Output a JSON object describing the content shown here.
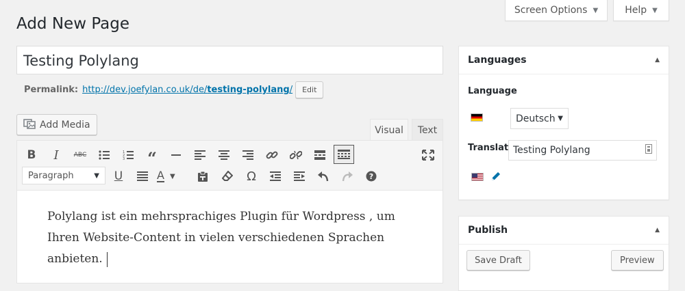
{
  "screen_options": {
    "label": "Screen Options"
  },
  "help": {
    "label": "Help"
  },
  "page_title": "Add New Page",
  "post_title": {
    "value": "Testing Polylang"
  },
  "permalink": {
    "label": "Permalink:",
    "url_prefix": "http://dev.joefylan.co.uk/de/",
    "slug": "testing-polylang",
    "url_suffix": "/",
    "edit_label": "Edit"
  },
  "editor": {
    "add_media_label": "Add Media",
    "tabs": {
      "visual": "Visual",
      "text": "Text"
    },
    "format_select": "Paragraph",
    "toolbar_icons": [
      "bold-icon",
      "italic-icon",
      "strikethrough-icon",
      "bullet-list-icon",
      "numbered-list-icon",
      "blockquote-icon",
      "horizontal-line-icon",
      "align-left-icon",
      "align-center-icon",
      "align-right-icon",
      "link-icon",
      "unlink-icon",
      "read-more-icon",
      "toolbar-toggle-icon",
      "fullscreen-icon",
      "underline-icon",
      "justify-icon",
      "text-color-icon",
      "paste-text-icon",
      "clear-format-icon",
      "special-char-icon",
      "outdent-icon",
      "indent-icon",
      "undo-icon",
      "redo-icon",
      "help-icon"
    ],
    "content": "Polylang ist ein mehrsprachiges Plugin für Wordpress , um Ihren Website-Content in vielen verschiedenen Sprachen anbieten."
  },
  "languages_box": {
    "title": "Languages",
    "language_label": "Language",
    "language_value": "Deutsch",
    "translations_label": "Translations",
    "translation_value": "Testing Polylang"
  },
  "publish_box": {
    "title": "Publish",
    "save_draft": "Save Draft",
    "preview": "Preview"
  },
  "colors": {
    "link": "#0073aa",
    "background": "#f1f1f1"
  }
}
